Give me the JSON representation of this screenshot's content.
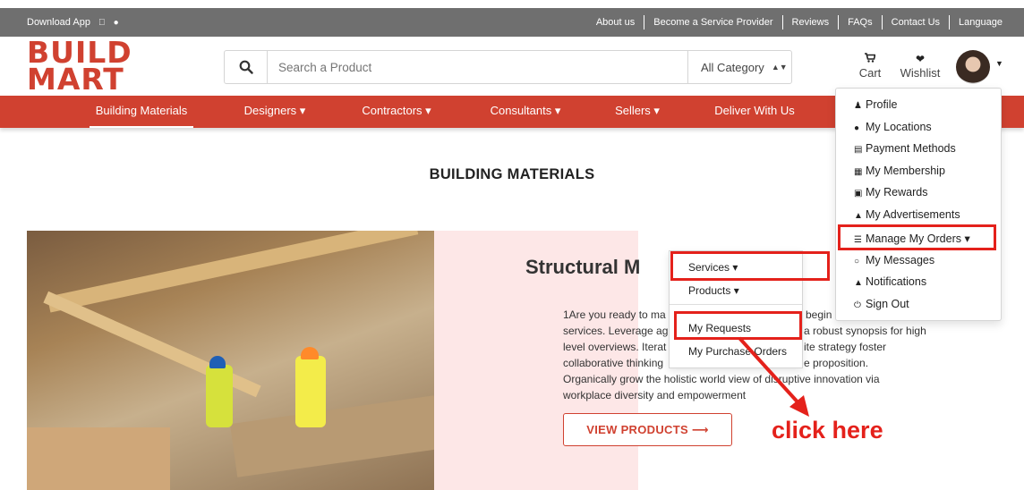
{
  "topbar": {
    "download_label": "Download App",
    "download_icons": [
      "apple-icon",
      "android-icon"
    ],
    "links": [
      "About us",
      "Become a Service Provider",
      "Reviews",
      "FAQs",
      "Contact Us",
      "Language"
    ]
  },
  "header": {
    "logo_line1": "BUILD",
    "logo_line2": "MART",
    "search_placeholder": "Search a Product",
    "category_selected": "All Category",
    "cart_label": "Cart",
    "wishlist_label": "Wishlist"
  },
  "nav": {
    "items": [
      {
        "label": "Building Materials",
        "active": true
      },
      {
        "label": "Designers ▾"
      },
      {
        "label": "Contractors ▾"
      },
      {
        "label": "Consultants ▾"
      },
      {
        "label": "Sellers ▾"
      },
      {
        "label": "Deliver With Us"
      }
    ]
  },
  "page": {
    "heading": "BUILDING MATERIALS",
    "section_title": "Structural M",
    "desc_lines": [
      "1Are you ready to ma",
      "services. Leverage ag",
      "level overviews. Iterat",
      "collaborative thinking",
      "Organically grow the holistic world view of disruptive innovation via",
      "workplace diversity and empowerment"
    ],
    "desc_right_fragments": [
      "begin",
      "a robust synopsis for high",
      "ite strategy foster",
      "e proposition."
    ],
    "view_button": "VIEW PRODUCTS ⟶"
  },
  "profile_menu": {
    "items": [
      {
        "label": "Profile",
        "icon": "user-icon"
      },
      {
        "label": "My Locations",
        "icon": "map-marker-icon"
      },
      {
        "label": "Payment Methods",
        "icon": "credit-card-icon"
      },
      {
        "label": "My Membership",
        "icon": "id-card-icon"
      },
      {
        "label": "My Rewards",
        "icon": "gift-icon"
      },
      {
        "label": "My Advertisements",
        "icon": "bullhorn-icon"
      },
      {
        "label": "Manage My Orders ▾",
        "icon": "list-icon"
      },
      {
        "label": "My Messages",
        "icon": "comments-icon"
      },
      {
        "label": "Notifications",
        "icon": "bell-icon"
      },
      {
        "label": "Sign Out",
        "icon": "power-icon"
      }
    ]
  },
  "orders_submenu": {
    "services": "Services ▾",
    "products": "Products ▾",
    "my_requests": "My Requests",
    "my_purchase_orders": "My Purchase Orders"
  },
  "annotation": {
    "text": "click here"
  },
  "colors": {
    "brand_red": "#d04130",
    "topbar_gray": "#6f6f6f",
    "highlight_red": "#e4211b",
    "pink_panel": "#fde7e7"
  }
}
